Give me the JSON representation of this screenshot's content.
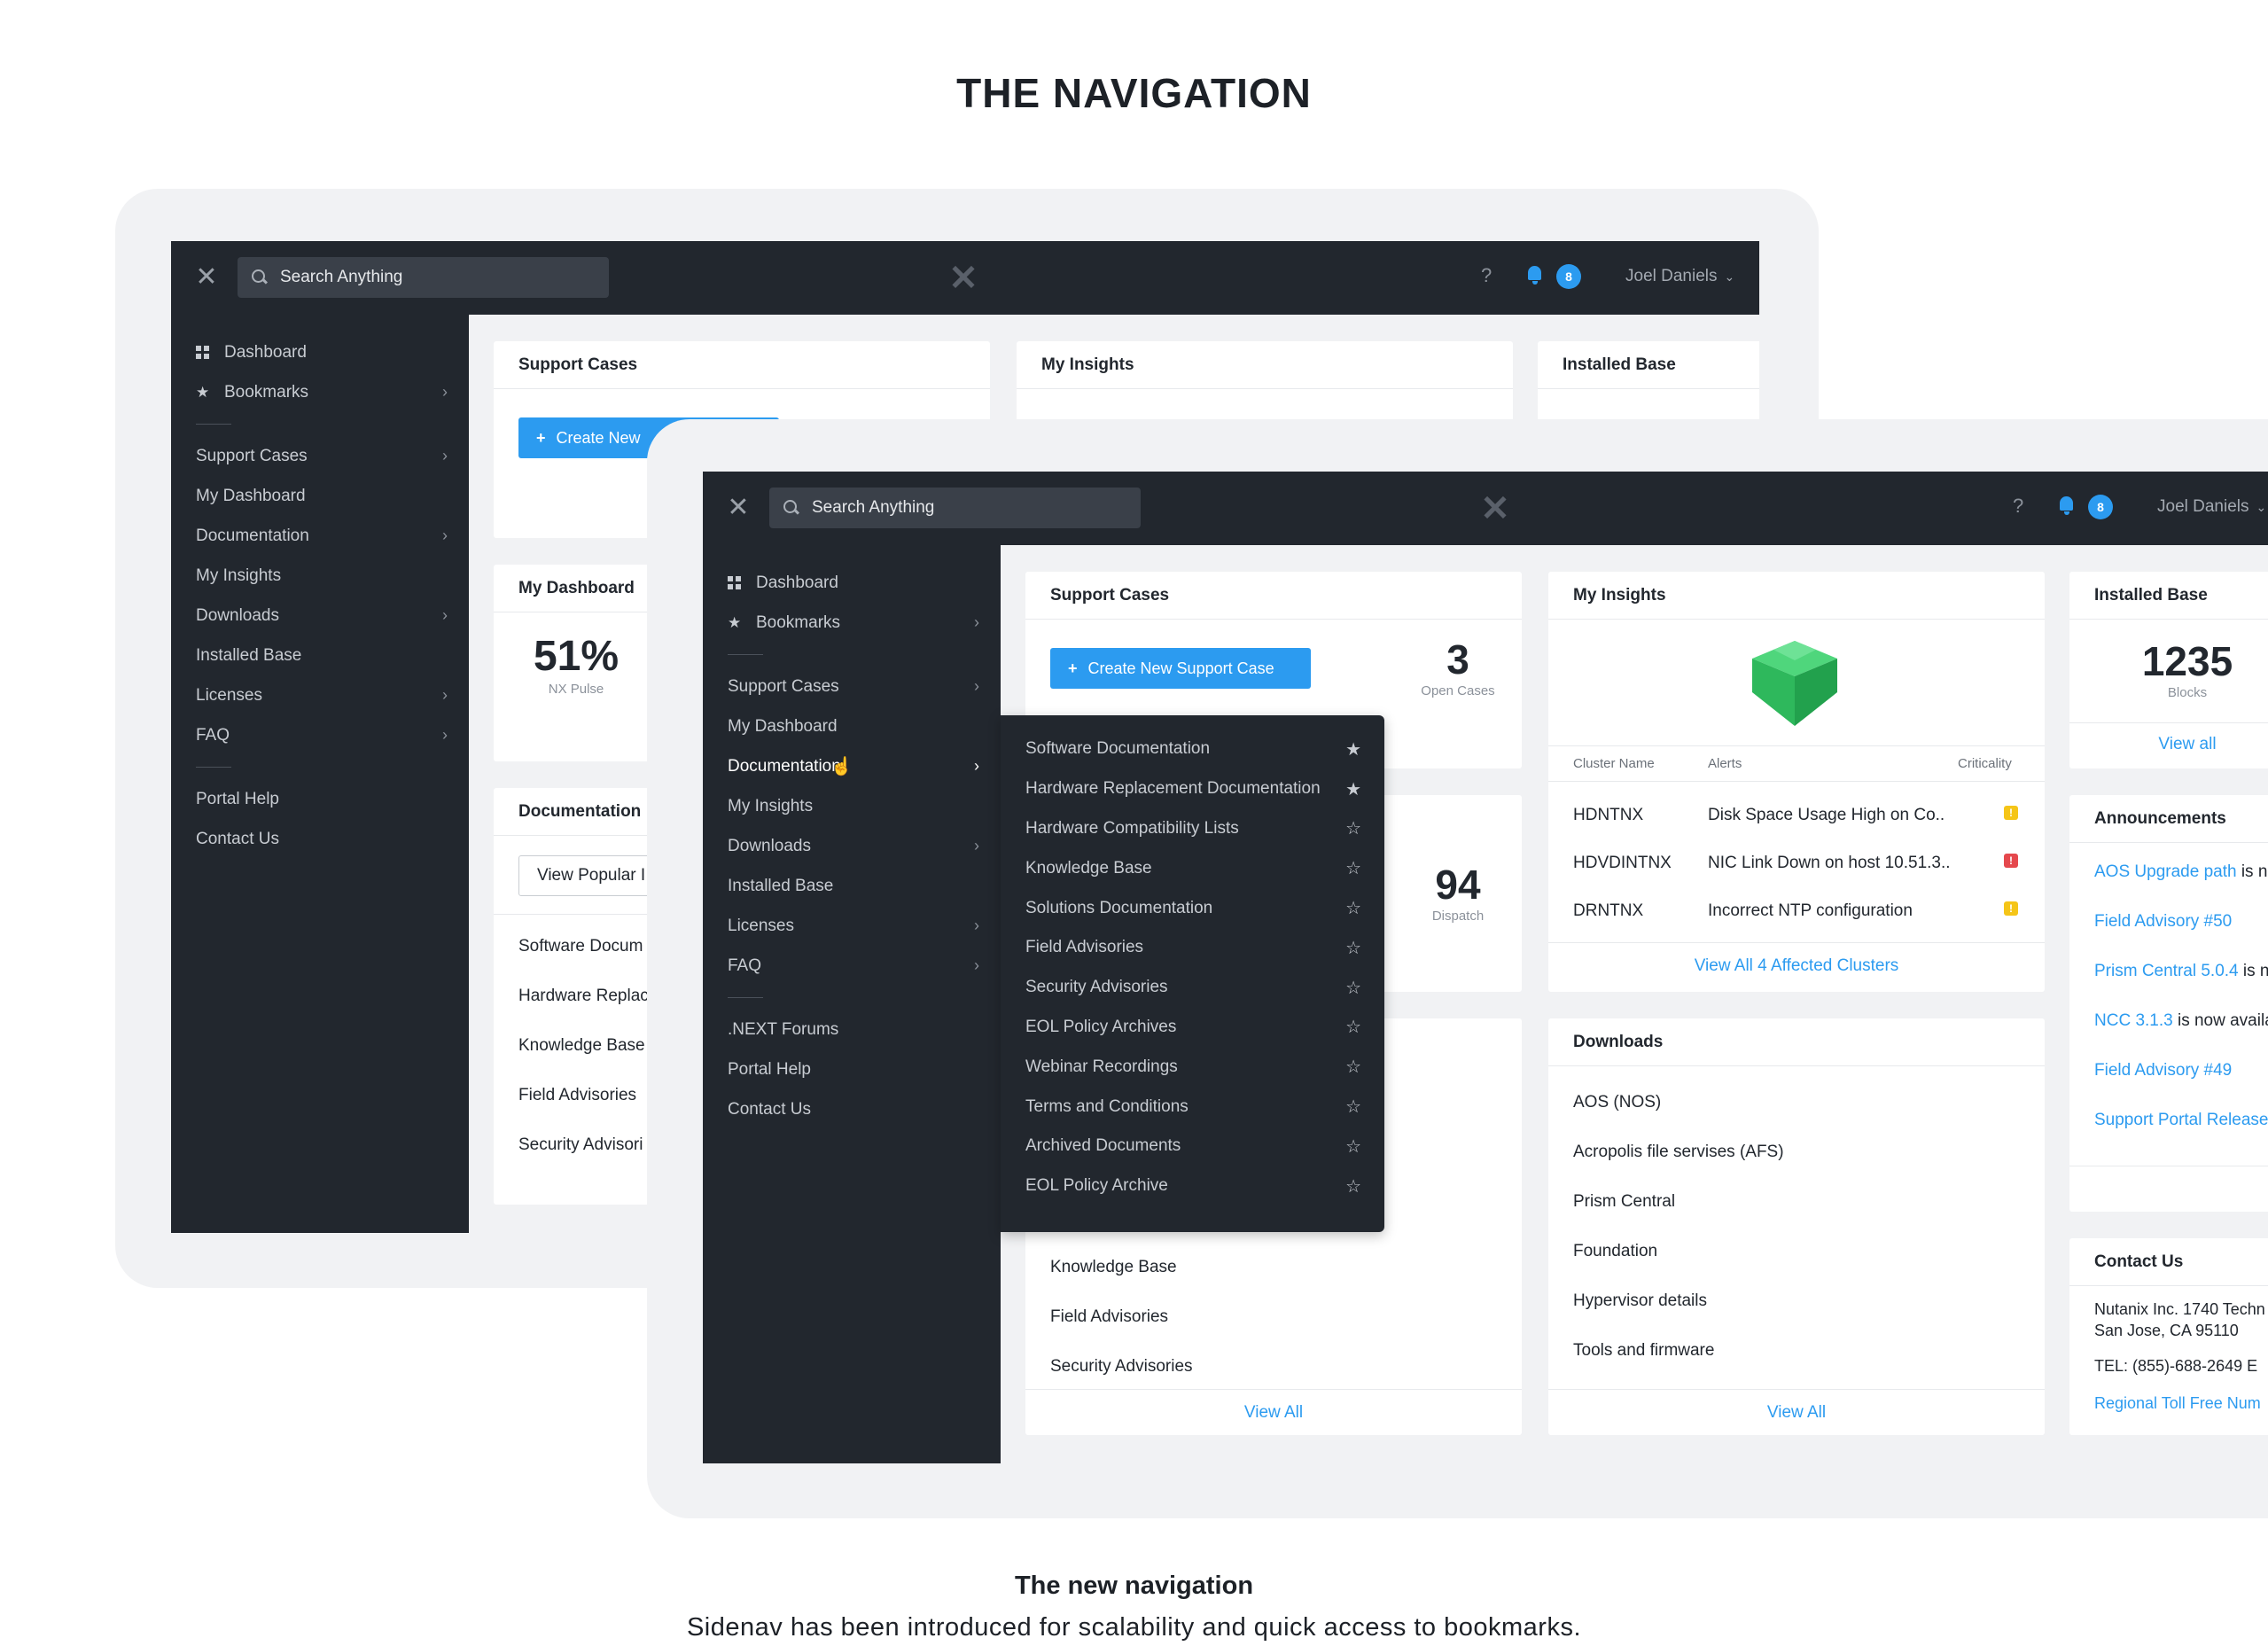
{
  "page": {
    "title": "THE NAVIGATION",
    "caption_title": "The new navigation",
    "caption_sub": "Sidenav has been introduced for scalability and quick access to bookmarks."
  },
  "colors": {
    "accent": "#2c9bf0",
    "dark": "#22272e",
    "background": "#f1f2f4",
    "green": "#2eb85c",
    "warning": "#f5c518",
    "danger": "#e5484d"
  },
  "topbar": {
    "close_icon": "close-icon",
    "search_placeholder": "Search Anything",
    "logo_icon": "x-logo-icon",
    "help": "?",
    "badge": "8",
    "user": "Joel Daniels"
  },
  "nav": {
    "top": [
      {
        "label": "Dashboard",
        "icon": "grid-icon"
      },
      {
        "label": "Bookmarks",
        "icon": "star-icon"
      }
    ],
    "back_main": [
      {
        "label": "Support Cases"
      },
      {
        "label": "My Dashboard"
      },
      {
        "label": "Documentation"
      },
      {
        "label": "My Insights"
      },
      {
        "label": "Downloads"
      },
      {
        "label": "Installed Base"
      },
      {
        "label": "Licenses"
      },
      {
        "label": "FAQ"
      }
    ],
    "back_bottom": [
      {
        "label": "Portal Help"
      },
      {
        "label": "Contact Us"
      }
    ],
    "front_main": [
      {
        "label": "Support Cases"
      },
      {
        "label": "My Dashboard"
      },
      {
        "label": "Documentation"
      },
      {
        "label": "My Insights"
      },
      {
        "label": "Downloads"
      },
      {
        "label": "Installed Base"
      },
      {
        "label": "Licenses"
      },
      {
        "label": "FAQ"
      }
    ],
    "front_bottom": [
      {
        "label": ".NEXT Forums"
      },
      {
        "label": "Portal Help"
      },
      {
        "label": "Contact Us"
      }
    ]
  },
  "flyout": [
    {
      "label": "Software Documentation",
      "starred": true
    },
    {
      "label": "Hardware Replacement Documentation",
      "starred": true
    },
    {
      "label": "Hardware Compatibility Lists",
      "starred": false
    },
    {
      "label": "Knowledge Base",
      "starred": false
    },
    {
      "label": "Solutions Documentation",
      "starred": false
    },
    {
      "label": "Field Advisories",
      "starred": false
    },
    {
      "label": "Security Advisories",
      "starred": false
    },
    {
      "label": "EOL Policy Archives",
      "starred": false
    },
    {
      "label": "Webinar Recordings",
      "starred": false
    },
    {
      "label": "Terms and Conditions",
      "starred": false
    },
    {
      "label": "Archived Documents",
      "starred": false
    },
    {
      "label": "EOL Policy Archive",
      "starred": false
    }
  ],
  "cards": {
    "support_cases": {
      "title": "Support Cases",
      "button": "Create New Support Case",
      "button_back": "Create New",
      "count": "3",
      "count_label": "Open Cases"
    },
    "my_insights": {
      "title": "My Insights"
    },
    "installed_base": {
      "title": "Installed Base",
      "count": "1235",
      "count_label": "Blocks",
      "link": "View all"
    },
    "my_dashboard": {
      "title": "My Dashboard",
      "pct": "51%",
      "pct_label": "NX Pulse"
    },
    "dispatch": {
      "count": "94",
      "label": "Dispatch"
    },
    "documentation": {
      "title": "Documentation",
      "button": "View Popular I",
      "items": [
        "Software Docum",
        "Hardware Replac",
        "Knowledge Base",
        "Field Advisories",
        "Security Advisori"
      ]
    },
    "front_doc_items": [
      "Knowledge Base",
      "Field Advisories",
      "Security Advisories"
    ],
    "front_doc_link": "View All",
    "clusters": {
      "headers": [
        "Cluster Name",
        "Alerts",
        "Criticality"
      ],
      "rows": [
        {
          "name": "HDNTNX",
          "alert": "Disk Space Usage High on Co..",
          "level": "warning"
        },
        {
          "name": "HDVDINTNX",
          "alert": "NIC Link Down on host 10.51.3..",
          "level": "danger"
        },
        {
          "name": "DRNTNX",
          "alert": "Incorrect NTP configuration",
          "level": "warning"
        }
      ],
      "link": "View All 4 Affected Clusters"
    },
    "downloads": {
      "title": "Downloads",
      "items": [
        "AOS (NOS)",
        "Acropolis file servises (AFS)",
        "Prism Central",
        "Foundation",
        "Hypervisor details",
        "Tools and firmware"
      ],
      "link": "View All"
    },
    "announcements": {
      "title": "Announcements",
      "items": [
        {
          "link": "AOS Upgrade path",
          "rest": " is n"
        },
        {
          "link": "Field Advisory #50",
          "rest": ""
        },
        {
          "link": "Prism Central 5.0.4",
          "rest": " is n"
        },
        {
          "link": "NCC 3.1.3",
          "rest": " is now availa"
        },
        {
          "link": "Field Advisory #49",
          "rest": ""
        },
        {
          "link": "Support Portal Release",
          "rest": ""
        }
      ]
    },
    "contact": {
      "title": "Contact Us",
      "line1": "Nutanix Inc. 1740 Techn",
      "line2": "San Jose, CA 95110",
      "tel": "TEL: (855)-688-2649 E",
      "link": "Regional Toll Free Num"
    }
  }
}
